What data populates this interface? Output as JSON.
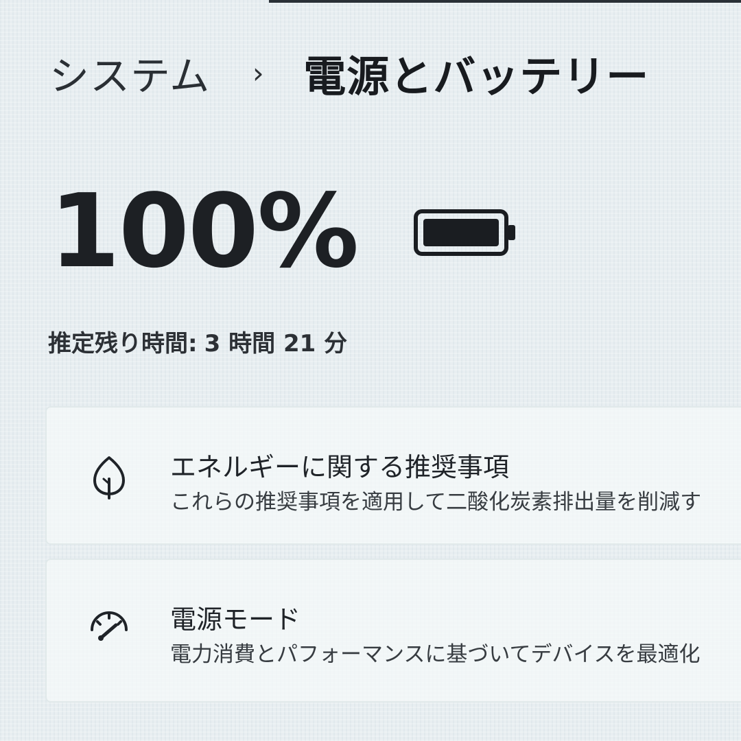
{
  "breadcrumb": {
    "parent": "システム",
    "separator": "›",
    "current": "電源とバッテリー"
  },
  "battery": {
    "percentage": "100%",
    "icon": "battery-full-icon",
    "remaining_label": "推定残り時間:",
    "remaining_value": "3 時間 21 分"
  },
  "settings": {
    "energy_recommendations": {
      "icon": "leaf-icon",
      "title": "エネルギーに関する推奨事項",
      "description": "これらの推奨事項を適用して二酸化炭素排出量を削減す"
    },
    "power_mode": {
      "icon": "gauge-icon",
      "title": "電源モード",
      "description": "電力消費とパフォーマンスに基づいてデバイスを最適化"
    }
  },
  "colors": {
    "background": "#e8eef1",
    "text": "#1b1b1b",
    "card": "#f5f9fa"
  }
}
